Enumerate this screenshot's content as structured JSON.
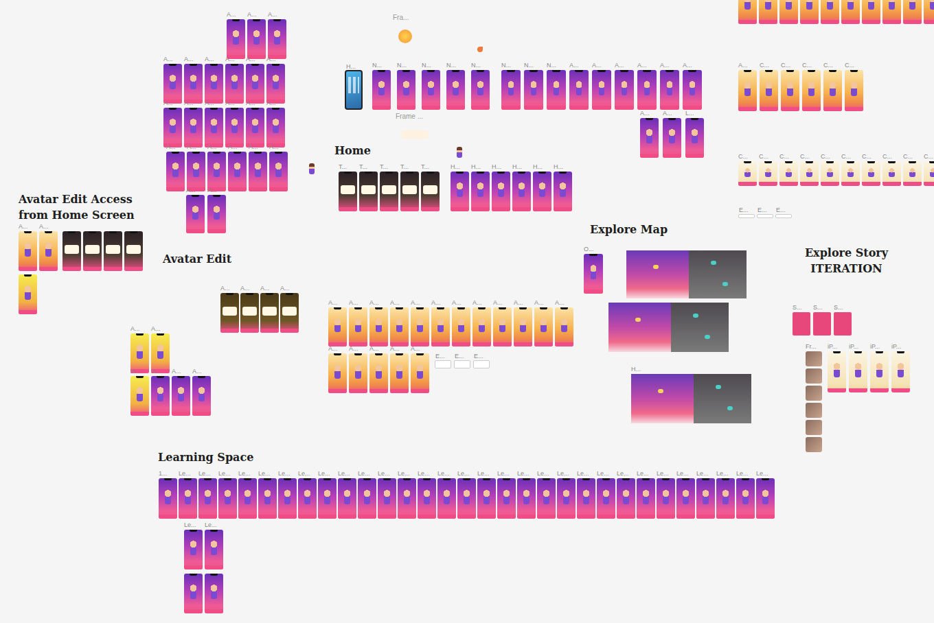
{
  "sections": [
    {
      "title": "Avatar Edit Access from Home Screen"
    },
    {
      "title": "Avatar Edit"
    },
    {
      "title": "Home"
    },
    {
      "title": "Explore Map"
    },
    {
      "title": "Explore Story ITERATION"
    },
    {
      "title": "Learning Space"
    }
  ],
  "notes": [
    {
      "text": "Fra..."
    },
    {
      "text": "Frame ..."
    }
  ],
  "groups": [
    {
      "kind": "purple",
      "frames": [
        {
          "label": "A..."
        },
        {
          "label": "A..."
        },
        {
          "label": "A..."
        }
      ]
    },
    {
      "kind": "purple",
      "frames": [
        {
          "label": "A..."
        },
        {
          "label": "A..."
        },
        {
          "label": "A..."
        },
        {
          "label": "A..."
        },
        {
          "label": "A..."
        },
        {
          "label": "A..."
        }
      ]
    },
    {
      "kind": "purple",
      "frames": [
        {
          "label": "A..."
        },
        {
          "label": "A..."
        },
        {
          "label": "A..."
        },
        {
          "label": "A..."
        },
        {
          "label": "A..."
        },
        {
          "label": "A..."
        }
      ]
    },
    {
      "kind": "purple",
      "frames": [
        {
          "label": "A..."
        },
        {
          "label": "A..."
        },
        {
          "label": "A..."
        },
        {
          "label": "A..."
        },
        {
          "label": "A..."
        },
        {
          "label": "A..."
        }
      ]
    },
    {
      "kind": "purple",
      "frames": [
        {
          "label": "A..."
        },
        {
          "label": "A..."
        }
      ]
    },
    {
      "kind": "ios",
      "frames": [
        {
          "label": "H..."
        }
      ]
    },
    {
      "kind": "purple",
      "frames": [
        {
          "label": "N..."
        },
        {
          "label": "N..."
        },
        {
          "label": "N..."
        },
        {
          "label": "N..."
        },
        {
          "label": "N..."
        }
      ]
    },
    {
      "kind": "purple",
      "frames": [
        {
          "label": "N..."
        },
        {
          "label": "N..."
        },
        {
          "label": "N..."
        },
        {
          "label": "A..."
        },
        {
          "label": "A..."
        },
        {
          "label": "A..."
        },
        {
          "label": "A..."
        },
        {
          "label": "A..."
        },
        {
          "label": "A..."
        }
      ]
    },
    {
      "kind": "purple",
      "frames": [
        {
          "label": "A..."
        },
        {
          "label": "A..."
        },
        {
          "label": "L..."
        }
      ]
    },
    {
      "kind": "dark",
      "frames": [
        {
          "label": "T..."
        },
        {
          "label": "T..."
        },
        {
          "label": "T..."
        },
        {
          "label": "T..."
        },
        {
          "label": "T..."
        }
      ]
    },
    {
      "kind": "purple",
      "frames": [
        {
          "label": "H..."
        },
        {
          "label": "H..."
        },
        {
          "label": "H..."
        },
        {
          "label": "H..."
        },
        {
          "label": "H..."
        },
        {
          "label": "H..."
        }
      ]
    },
    {
      "kind": "orange",
      "frames": [
        {
          "label": "A..."
        },
        {
          "label": "A..."
        }
      ]
    },
    {
      "kind": "dark",
      "frames": [
        {},
        {},
        {},
        {}
      ]
    },
    {
      "kind": "lime",
      "frames": [
        {}
      ]
    },
    {
      "kind": "olive",
      "frames": [
        {
          "label": "A..."
        },
        {
          "label": "A..."
        },
        {
          "label": "A..."
        },
        {
          "label": "A..."
        }
      ]
    },
    {
      "kind": "lime",
      "frames": [
        {
          "label": "A..."
        },
        {
          "label": "A..."
        }
      ]
    },
    {
      "kind": "lime",
      "frames": [
        {
          "label": "A..."
        }
      ]
    },
    {
      "kind": "purple",
      "frames": [
        {
          "label": "A..."
        },
        {
          "label": "A..."
        },
        {
          "label": "A..."
        }
      ]
    },
    {
      "kind": "orange",
      "frames": [
        {
          "label": "A..."
        },
        {
          "label": "A..."
        },
        {
          "label": "A..."
        },
        {
          "label": "A..."
        },
        {
          "label": "A..."
        },
        {
          "label": "A..."
        },
        {
          "label": "A..."
        },
        {
          "label": "A..."
        },
        {
          "label": "A..."
        },
        {
          "label": "A..."
        },
        {
          "label": "A..."
        },
        {
          "label": "A..."
        }
      ]
    },
    {
      "kind": "orange",
      "frames": [
        {
          "label": "A..."
        },
        {
          "label": "A..."
        },
        {
          "label": "A..."
        },
        {
          "label": "A..."
        },
        {
          "label": "A..."
        }
      ]
    },
    {
      "kind": "note",
      "frames": [
        {
          "label": "E..."
        },
        {
          "label": "E..."
        },
        {
          "label": "E..."
        }
      ]
    },
    {
      "kind": "purple",
      "frames": [
        {
          "label": "O..."
        }
      ]
    },
    {
      "kind": "map",
      "frames": [
        {}
      ]
    },
    {
      "kind": "map",
      "frames": [
        {}
      ]
    },
    {
      "kind": "map",
      "frames": [
        {
          "label": "H..."
        }
      ]
    },
    {
      "kind": "card",
      "frames": [
        {
          "label": "S..."
        },
        {
          "label": "S..."
        },
        {
          "label": "S..."
        }
      ]
    },
    {
      "kind": "purple",
      "frames": [
        {
          "label": "1..."
        },
        {
          "label": "Le..."
        },
        {
          "label": "Le..."
        },
        {
          "label": "Le..."
        },
        {
          "label": "Le..."
        },
        {
          "label": "Le..."
        },
        {
          "label": "Le..."
        },
        {
          "label": "Le..."
        },
        {
          "label": "Le..."
        },
        {
          "label": "Le..."
        },
        {
          "label": "Le..."
        },
        {
          "label": "Le..."
        },
        {
          "label": "Le..."
        },
        {
          "label": "Le..."
        },
        {
          "label": "Le..."
        },
        {
          "label": "Le..."
        },
        {
          "label": "Le..."
        },
        {
          "label": "Le..."
        },
        {
          "label": "Le..."
        },
        {
          "label": "Le..."
        },
        {
          "label": "Le..."
        },
        {
          "label": "Le..."
        },
        {
          "label": "Le..."
        },
        {
          "label": "Le..."
        },
        {
          "label": "Le..."
        },
        {
          "label": "Le..."
        },
        {
          "label": "Le..."
        },
        {
          "label": "Le..."
        },
        {
          "label": "Le..."
        },
        {
          "label": "Le..."
        },
        {
          "label": "Le..."
        }
      ]
    },
    {
      "kind": "purple",
      "frames": [
        {
          "label": "Le..."
        },
        {
          "label": "Le..."
        }
      ]
    },
    {
      "kind": "purple",
      "frames": [
        {},
        {}
      ]
    },
    {
      "kind": "orange",
      "frames": [
        {},
        {},
        {},
        {},
        {},
        {},
        {},
        {},
        {},
        {}
      ]
    },
    {
      "kind": "orange",
      "frames": [
        {
          "label": "A..."
        },
        {
          "label": "C..."
        },
        {
          "label": "C..."
        },
        {
          "label": "C..."
        },
        {
          "label": "C..."
        },
        {
          "label": "C..."
        }
      ]
    },
    {
      "kind": "cream",
      "frames": [
        {
          "label": "C..."
        },
        {
          "label": "C..."
        },
        {
          "label": "C..."
        },
        {
          "label": "C..."
        },
        {
          "label": "C..."
        },
        {
          "label": "C..."
        },
        {
          "label": "C..."
        },
        {
          "label": "C..."
        },
        {
          "label": "C..."
        },
        {
          "label": "C..."
        }
      ]
    },
    {
      "kind": "note",
      "frames": [
        {
          "label": "E..."
        },
        {
          "label": "E..."
        },
        {
          "label": "E..."
        }
      ]
    },
    {
      "kind": "photo",
      "frames": [
        {
          "label": "Fr..."
        },
        {},
        {},
        {},
        {},
        {}
      ]
    },
    {
      "kind": "cream",
      "frames": [
        {
          "label": "iP..."
        },
        {
          "label": "iP..."
        },
        {
          "label": "iP..."
        },
        {
          "label": "iP..."
        }
      ]
    }
  ]
}
